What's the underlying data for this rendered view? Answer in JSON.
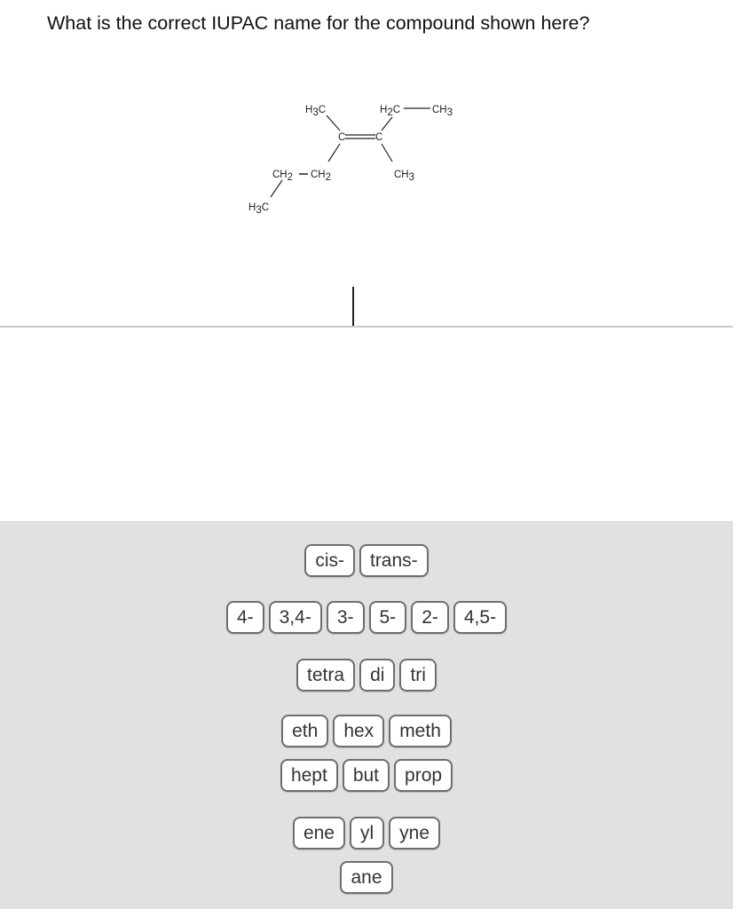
{
  "question": "What is the correct IUPAC name for the compound shown here?",
  "structure": {
    "labels": {
      "top_left": [
        "H",
        "3",
        "C"
      ],
      "top_right_ch2": [
        "H",
        "2",
        "C"
      ],
      "top_right_ch3": [
        "CH",
        "3"
      ],
      "c_left": "C",
      "c_right": "C",
      "ch2_a": [
        "CH",
        "2"
      ],
      "ch2_b": [
        "CH",
        "2"
      ],
      "right_ch3": [
        "CH",
        "3"
      ],
      "bottom_h3c": [
        "H",
        "3",
        "C"
      ]
    }
  },
  "answer": {
    "value": ""
  },
  "tile_bank": {
    "rows": [
      [
        "cis-",
        "trans-"
      ],
      [
        "4-",
        "3,4-",
        "3-",
        "5-",
        "2-",
        "4,5-"
      ],
      [
        "tetra",
        "di",
        "tri"
      ],
      [
        "eth",
        "hex",
        "meth"
      ],
      [
        "hept",
        "but",
        "prop"
      ],
      [
        "ene",
        "yl",
        "yne"
      ],
      [
        "ane"
      ]
    ]
  }
}
